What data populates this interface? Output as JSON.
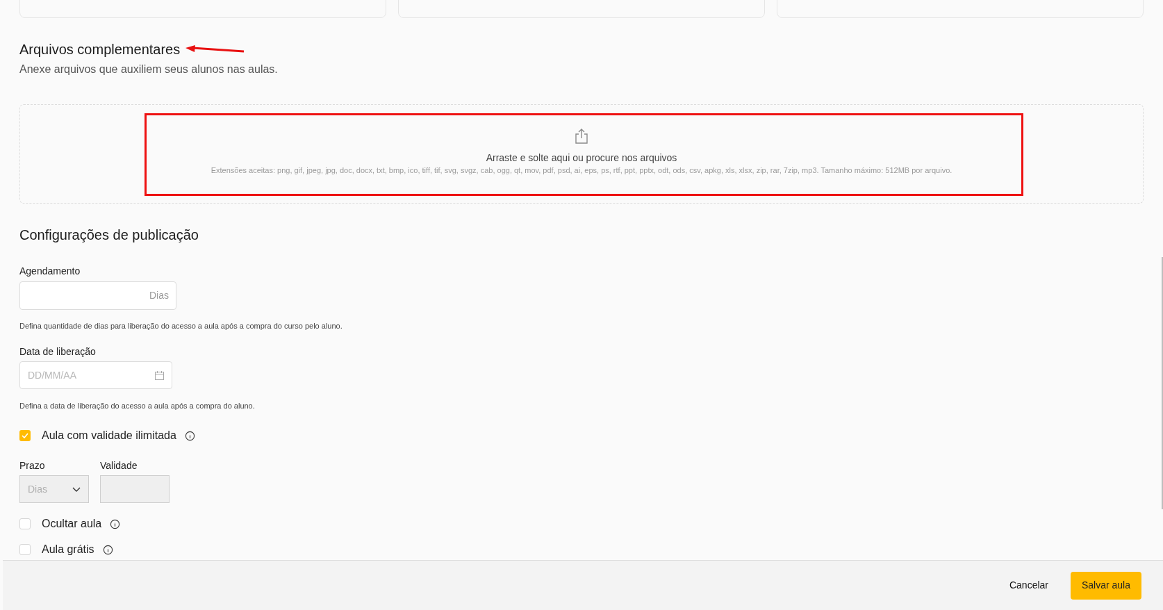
{
  "attachments": {
    "title": "Arquivos complementares",
    "subtitle": "Anexe arquivos que auxiliem seus alunos nas aulas.",
    "dropzone": {
      "text": "Arraste e solte aqui ou procure nos arquivos",
      "hint": "Extensões aceitas: png, gif, jpeg, jpg, doc, docx, txt, bmp, ico, tiff, tif, svg, svgz, cab, ogg, qt, mov, pdf, psd, ai, eps, ps, rtf, ppt, pptx, odt, ods, csv, apkg, xls, xlsx, zip, rar, 7zip, mp3. Tamanho máximo: 512MB por arquivo."
    }
  },
  "publication": {
    "title": "Configurações de publicação",
    "schedule": {
      "label": "Agendamento",
      "suffix": "Dias",
      "help": "Defina quantidade de dias para liberação do acesso a aula após a compra do curso pelo aluno."
    },
    "release_date": {
      "label": "Data de liberação",
      "placeholder": "DD/MM/AA",
      "help": "Defina a data de liberação do acesso a aula após a compra do aluno."
    },
    "unlimited": {
      "label": "Aula com validade ilimitada",
      "checked": true
    },
    "term": {
      "label": "Prazo",
      "value": "Dias",
      "disabled": true
    },
    "validity": {
      "label": "Validade",
      "disabled": true
    },
    "options": [
      {
        "label": "Ocultar aula",
        "checked": false
      },
      {
        "label": "Aula grátis",
        "checked": false
      }
    ]
  },
  "footer": {
    "cancel": "Cancelar",
    "save": "Salvar aula"
  }
}
